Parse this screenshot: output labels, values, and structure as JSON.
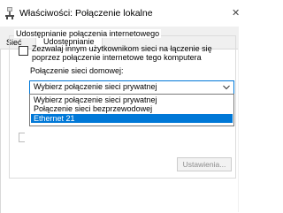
{
  "window": {
    "title": "Właściwości: Połączenie lokalne"
  },
  "tabs": [
    {
      "label": "Sieć"
    },
    {
      "label": "Udostępnianie"
    }
  ],
  "sharing": {
    "group_title": "Udostępnianie połączenia internetowego",
    "allow_checkbox": {
      "line1": "Zezwalaj innym użytkownikom sieci na łączenie się",
      "line2": "poprzez połączenie internetowe tego komputera",
      "checked": false
    },
    "home_network_label": "Połączenie sieci domowej:",
    "combo_value": "Wybierz połączenie sieci prywatnej",
    "options": [
      "Wybierz połączenie sieci prywatnej",
      "Połączenie sieci bezprzewodowej",
      "Ethernet 21"
    ],
    "selected_option_index": 2,
    "settings_button": "Ustawienia..."
  },
  "colors": {
    "accent": "#0078d7",
    "selection_text": "#ffffff",
    "disabled_text": "#8c8c8c"
  },
  "icons": {
    "title_icon": "network-connection-icon",
    "combo_arrow": "chevron-down-icon"
  }
}
